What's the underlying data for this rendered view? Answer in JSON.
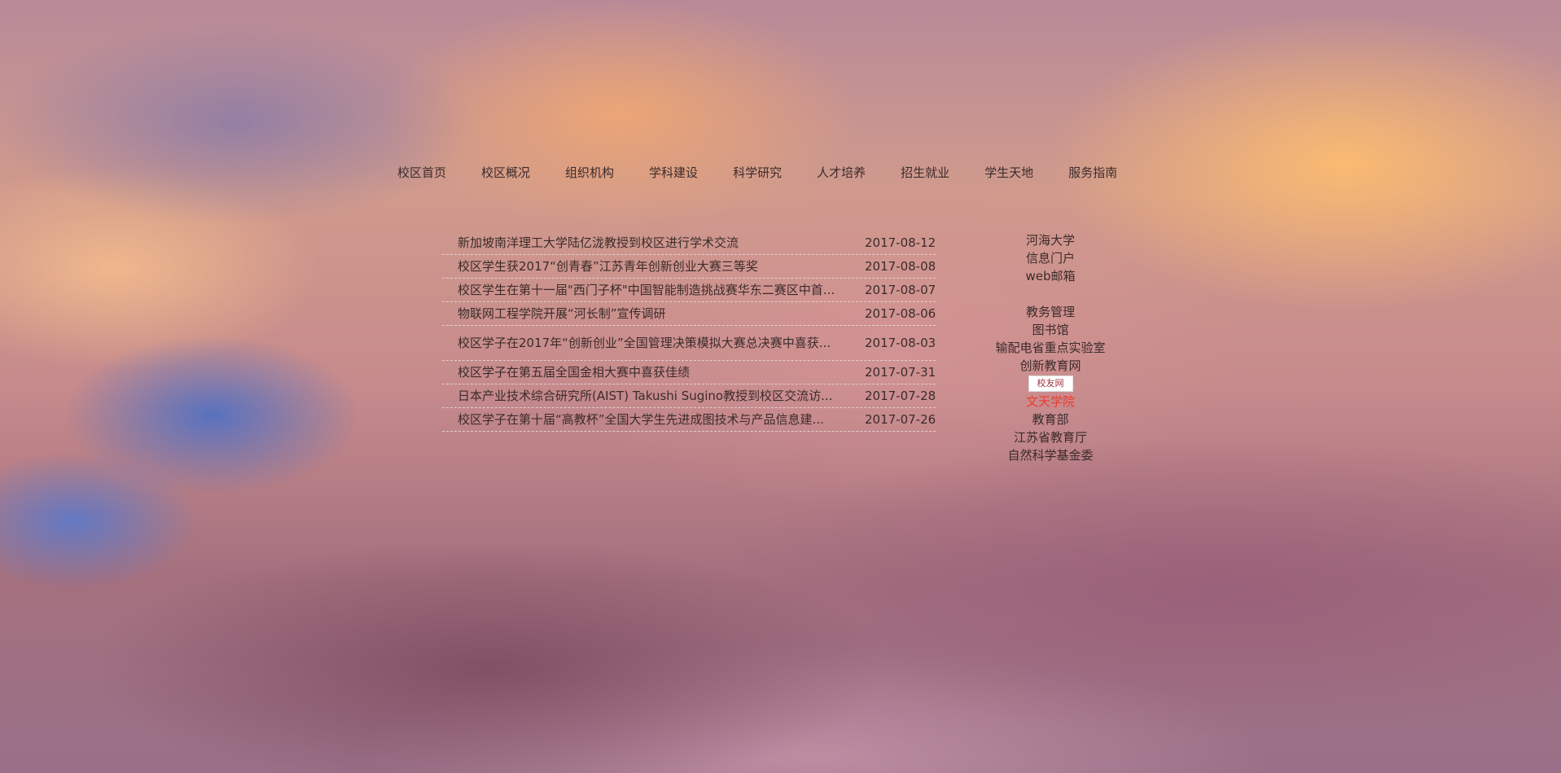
{
  "nav": {
    "items": [
      "校区首页",
      "校区概况",
      "组织机构",
      "学科建设",
      "科学研究",
      "人才培养",
      "招生就业",
      "学生天地",
      "服务指南"
    ]
  },
  "news": [
    {
      "title": "新加坡南洋理工大学陆亿泷教授到校区进行学术交流",
      "date": "2017-08-12"
    },
    {
      "title": "校区学生获2017“创青春”江苏青年创新创业大赛三等奖",
      "date": "2017-08-08"
    },
    {
      "title": "校区学生在第十一届\"西门子杯\"中国智能制造挑战赛华东二赛区中首...",
      "date": "2017-08-07"
    },
    {
      "title": "物联网工程学院开展“河长制”宣传调研",
      "date": "2017-08-06"
    },
    {
      "title": "校区学子在2017年“创新创业”全国管理决策模拟大赛总决赛中喜获...",
      "date": "2017-08-03"
    },
    {
      "title": "校区学子在第五届全国金相大赛中喜获佳绩",
      "date": "2017-07-31"
    },
    {
      "title": "日本产业技术综合研究所(AIST) Takushi Sugino教授到校区交流访...",
      "date": "2017-07-28"
    },
    {
      "title": "校区学子在第十届“高教杯”全国大学生先进成图技术与产品信息建...",
      "date": "2017-07-26"
    }
  ],
  "links": {
    "group1": [
      "河海大学",
      "信息门户",
      "web邮箱"
    ],
    "group2": [
      "教务管理",
      "图书馆",
      "输配电省重点实验室",
      "创新教育网"
    ],
    "badge": "校友网",
    "highlight": "文天学院",
    "group3": [
      "教育部",
      "江苏省教育厅",
      "自然科学基金委"
    ],
    "highlight_color": "#ef3a2e"
  }
}
